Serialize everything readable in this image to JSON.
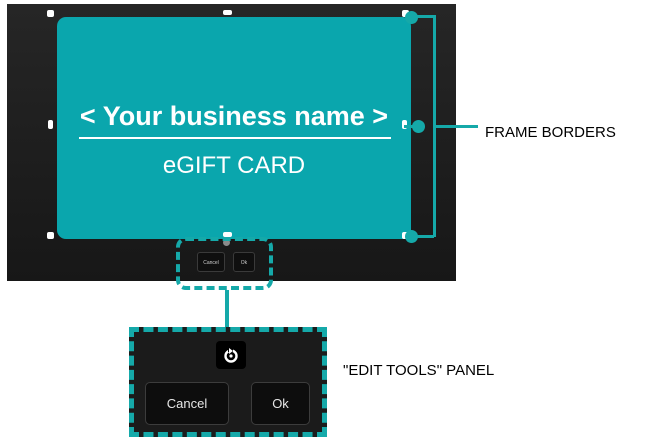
{
  "card": {
    "title": "< Your business name >",
    "subtitle": "eGIFT CARD",
    "color": "#0aa6ad"
  },
  "mini_toolbar": {
    "cancel_label": "Cancel",
    "ok_label": "Ok"
  },
  "edit_panel": {
    "rotate_icon": "rotate-icon",
    "cancel_label": "Cancel",
    "ok_label": "Ok"
  },
  "annotations": {
    "frame_borders": "FRAME BORDERS",
    "edit_tools_panel": "\"EDIT TOOLS\" PANEL",
    "accent_color": "#15a9a9"
  }
}
